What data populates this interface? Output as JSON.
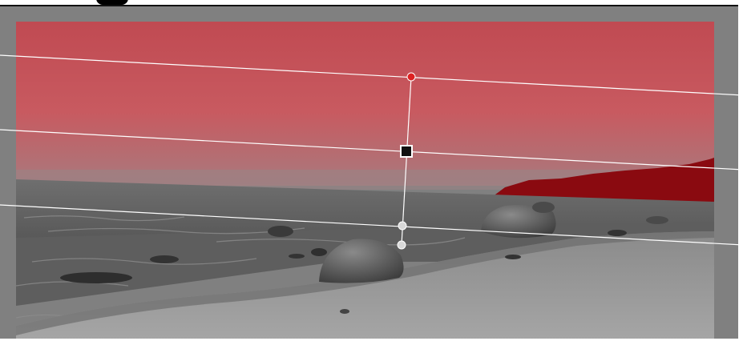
{
  "app": {
    "tool": "graduated-filter",
    "mask_color": "#cc4444",
    "mask_opacity": 0.75
  },
  "canvas": {
    "background": "#808080",
    "photo": "beach-with-boulders-grayscale"
  },
  "filter": {
    "handles": [
      "top-edge-handle",
      "center-pin",
      "bottom-edge-handle",
      "rotation-handle"
    ],
    "pin_color": "#111111",
    "top_handle_color": "#dd2222",
    "lower_handle_color": "#d8d8d8"
  }
}
